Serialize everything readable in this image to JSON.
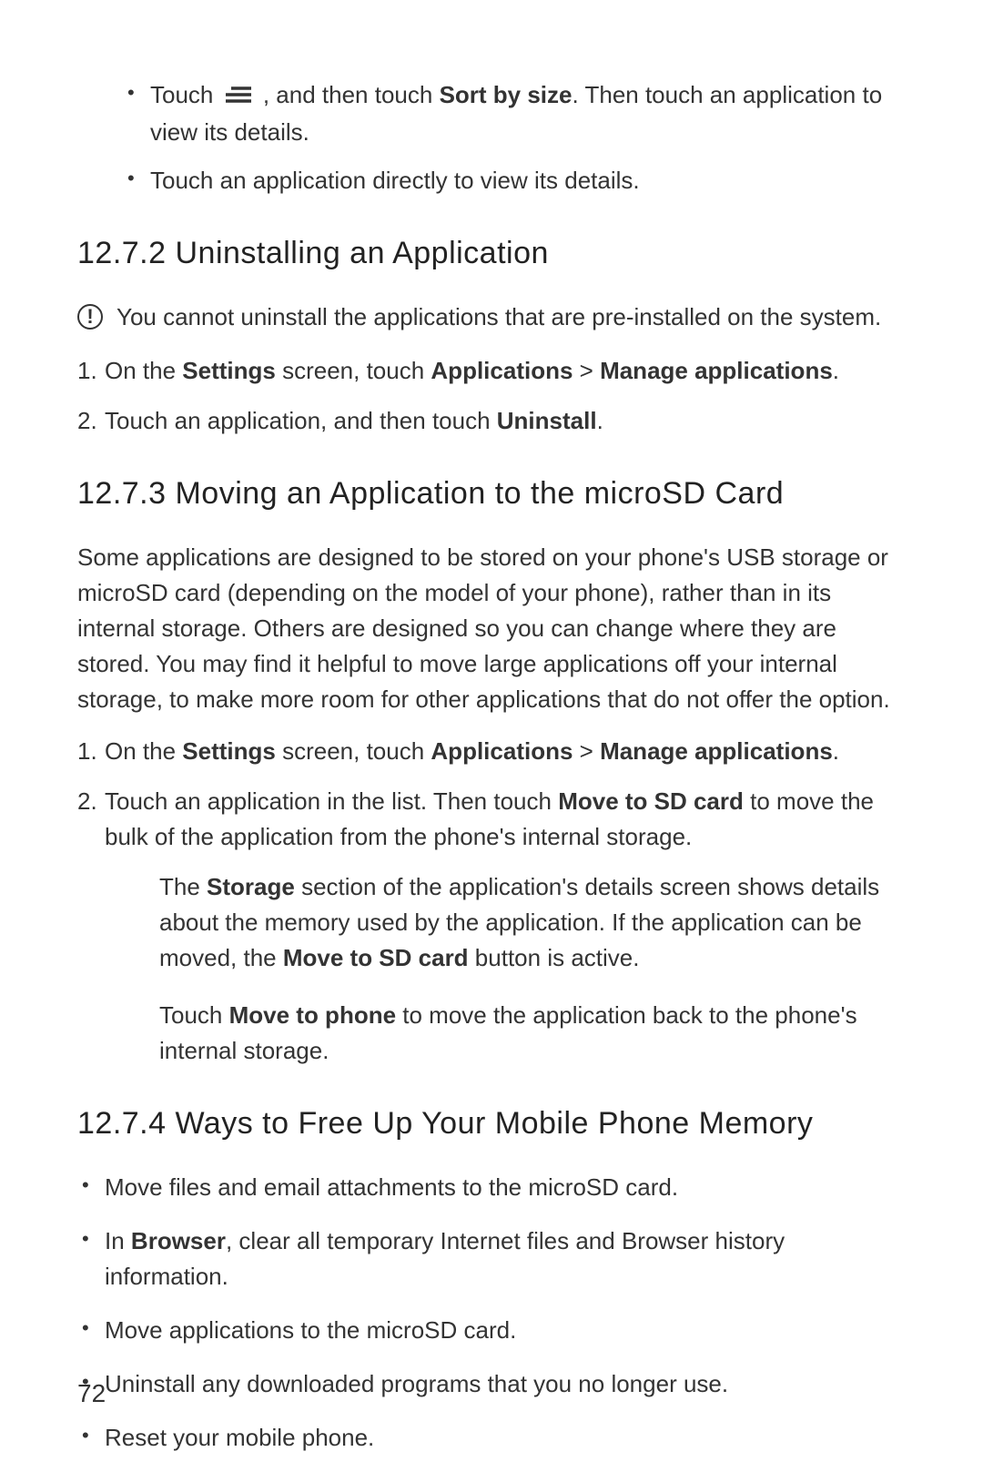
{
  "top_bullets": {
    "item1": {
      "pre": "Touch ",
      "mid": " , and then touch ",
      "bold1": "Sort by size",
      "post": ". Then touch an application to view its details."
    },
    "item2": "Touch an application directly to view its details."
  },
  "section_1272": {
    "heading": "12.7.2  Uninstalling an Application",
    "note": "You cannot uninstall the applications that are pre-installed on the system.",
    "step1": {
      "p1": "On the ",
      "b1": "Settings",
      "p2": " screen, touch ",
      "b2": "Applications",
      "p3": " > ",
      "b3": "Manage applications",
      "p4": "."
    },
    "step2": {
      "p1": "Touch an application, and then touch ",
      "b1": "Uninstall",
      "p2": "."
    }
  },
  "section_1273": {
    "heading": "12.7.3  Moving an Application to the microSD Card",
    "intro": "Some applications are designed to be stored on your phone's USB storage or microSD card (depending on the model of your phone), rather than in its internal storage. Others are designed so you can change where they are stored. You may find it helpful to move large applications off your internal storage, to make more room for other applications that do not offer the option.",
    "step1": {
      "p1": "On the ",
      "b1": "Settings",
      "p2": " screen, touch ",
      "b2": "Applications",
      "p3": " > ",
      "b3": "Manage applications",
      "p4": "."
    },
    "step2": {
      "p1": "Touch an application in the list. Then touch ",
      "b1": "Move to SD card",
      "p2": " to move the bulk of the application from the phone's internal storage."
    },
    "sub_p1": {
      "t1": "The ",
      "b1": "Storage",
      "t2": " section of the application's details screen shows details about the memory used by the application. If the application can be moved, the ",
      "b2": "Move to SD card",
      "t3": " button is active."
    },
    "sub_p2": {
      "t1": "Touch ",
      "b1": "Move to phone",
      "t2": " to move the application back to the phone's internal storage."
    }
  },
  "section_1274": {
    "heading": "12.7.4  Ways to Free Up Your Mobile Phone Memory",
    "bullets": {
      "b1": "Move files and email attachments to the microSD card.",
      "b2": {
        "t1": "In ",
        "bold": "Browser",
        "t2": ", clear all temporary Internet files and Browser history information."
      },
      "b3": "Move applications to the microSD card.",
      "b4": "Uninstall any downloaded programs that you no longer use.",
      "b5": "Reset your mobile phone."
    }
  },
  "page_number": "72"
}
